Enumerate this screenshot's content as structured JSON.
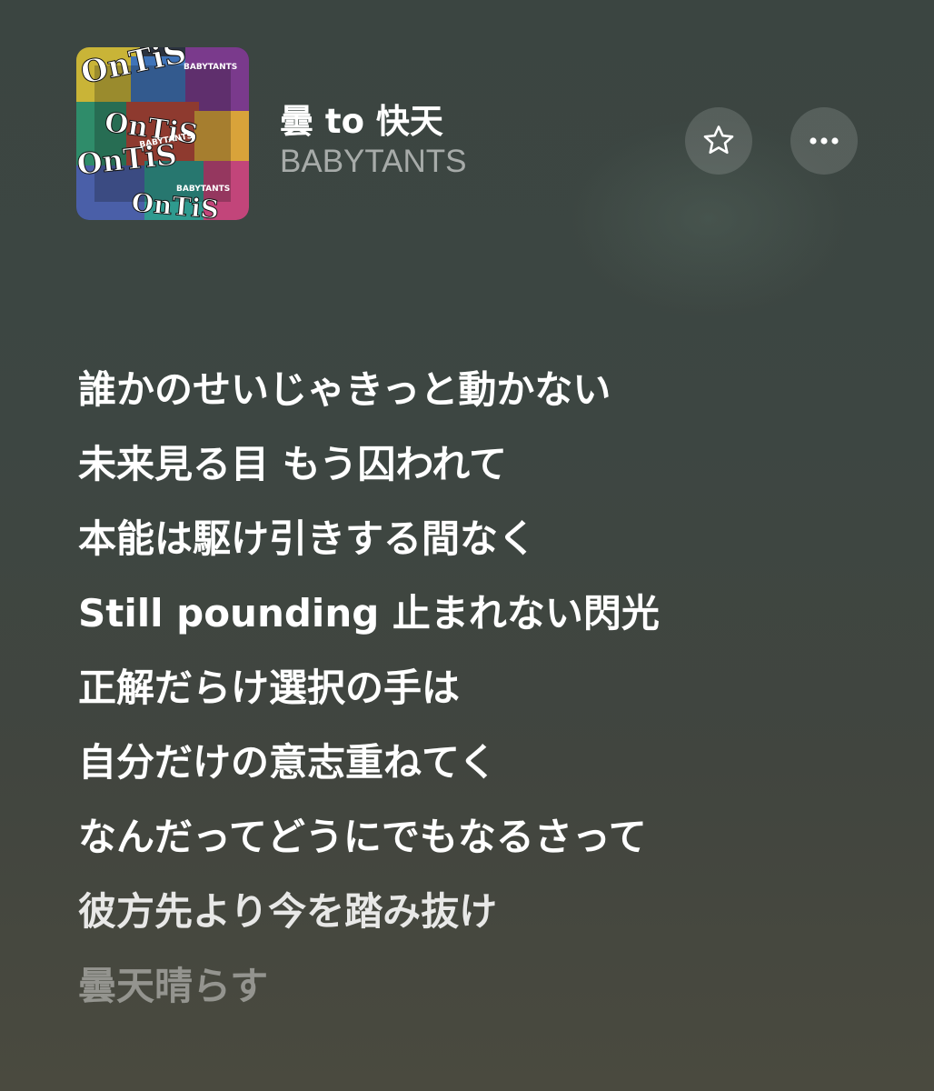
{
  "now_playing": {
    "title": "曇 to 快天",
    "artist": "BABYTANTS",
    "artwork": {
      "text": "OnTiS BABYTANTS"
    },
    "favorite_icon": "star-outline-icon",
    "more_icon": "ellipsis-icon"
  },
  "lyrics": {
    "lines": [
      "誰かのせいじゃきっと動かない",
      "未来見る目 もう囚われて",
      "本能は駆け引きする間なく",
      "Still pounding 止まれない閃光",
      "正解だらけ選択の手は",
      "自分だけの意志重ねてく",
      "なんだってどうにでもなるさって",
      "彼方先より今を踏み抜け",
      "曇天晴らす"
    ]
  },
  "colors": {
    "background_top": "#3b4541",
    "background_bottom": "#4a4a3f",
    "lyric_active": "#ffffff",
    "lyric_inactive": "rgba(255,255,255,0.42)",
    "artist_text": "rgba(255,255,255,0.55)"
  }
}
